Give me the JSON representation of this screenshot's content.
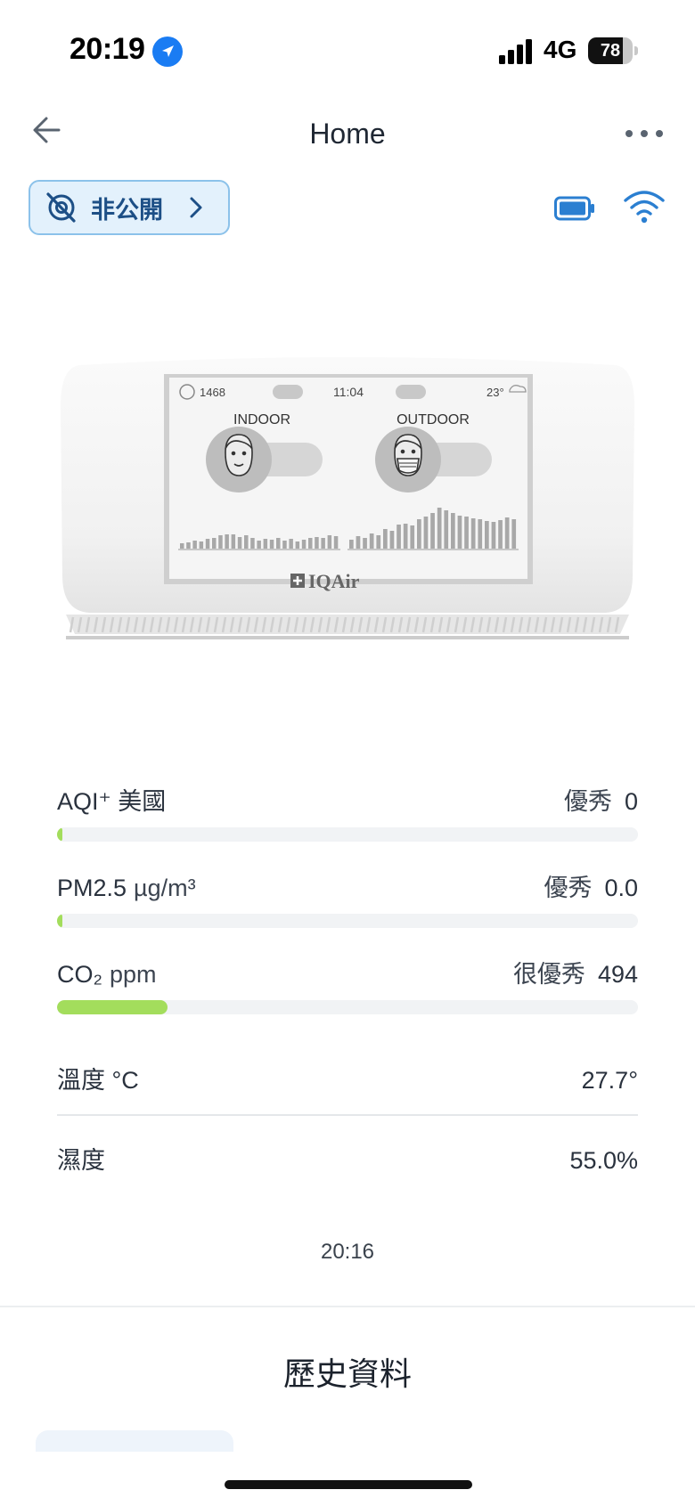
{
  "status_bar": {
    "time": "20:19",
    "network": "4G",
    "battery_level": "78",
    "battery_fraction": 0.78
  },
  "header": {
    "title": "Home"
  },
  "privacy": {
    "label": "非公開"
  },
  "device_screen": {
    "count": "1468",
    "time": "11:04",
    "temp": "23°",
    "indoor_label": "INDOOR",
    "outdoor_label": "OUTDOOR",
    "brand": "IQAir",
    "indoor_bars": [
      6,
      7,
      9,
      8,
      11,
      12,
      15,
      16,
      16,
      13,
      15,
      12,
      9,
      11,
      10,
      12,
      9,
      11,
      8,
      10,
      12,
      13,
      12,
      15,
      14
    ],
    "outdoor_bars": [
      10,
      14,
      12,
      17,
      15,
      22,
      20,
      27,
      28,
      26,
      33,
      36,
      40,
      46,
      43,
      40,
      37,
      36,
      34,
      33,
      31,
      30,
      32,
      35,
      33
    ]
  },
  "metrics": [
    {
      "name": "AQI⁺ 美國",
      "unit": "",
      "status": "優秀",
      "value": "0",
      "fill": 0.01
    },
    {
      "name": "PM2.5",
      "unit": "µg/m³",
      "status": "優秀",
      "value": "0.0",
      "fill": 0.01
    },
    {
      "name": "CO₂",
      "unit": "ppm",
      "status": "很優秀",
      "value": "494",
      "fill": 0.19
    }
  ],
  "temperature": {
    "label": "溫度 °C",
    "value": "27.7°"
  },
  "humidity": {
    "label": "濕度",
    "value": "55.0%"
  },
  "updated_time": "20:16",
  "history": {
    "title": "歷史資料"
  },
  "colors": {
    "accent": "#2b7fd1",
    "good_bar": "#a3dd5c",
    "pill_bg": "#e3f1fc",
    "pill_border": "#8cc2ea"
  }
}
